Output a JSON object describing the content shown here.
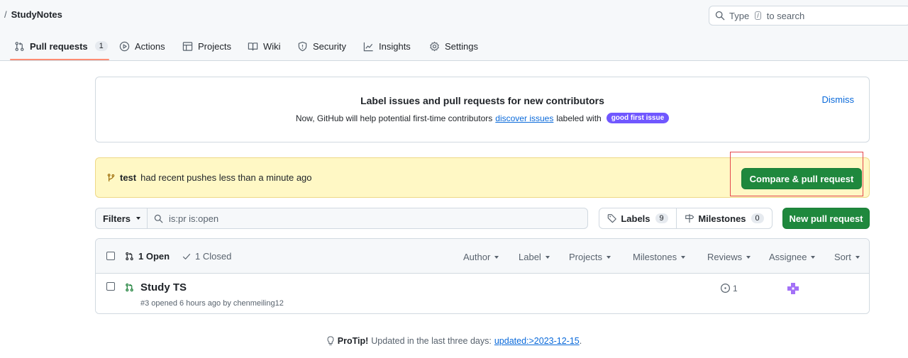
{
  "header": {
    "owner_fragment": "",
    "separator": "/",
    "repo_name": "StudyNotes",
    "search_prefix": "Type",
    "search_key": "/",
    "search_suffix": "to search"
  },
  "nav": {
    "items": [
      {
        "label": "Pull requests",
        "icon": "git-pull-request-icon",
        "counter": "1"
      },
      {
        "label": "Actions",
        "icon": "play-icon"
      },
      {
        "label": "Projects",
        "icon": "table-icon"
      },
      {
        "label": "Wiki",
        "icon": "book-icon"
      },
      {
        "label": "Security",
        "icon": "shield-icon"
      },
      {
        "label": "Insights",
        "icon": "graph-icon"
      },
      {
        "label": "Settings",
        "icon": "gear-icon"
      }
    ]
  },
  "banner": {
    "title": "Label issues and pull requests for new contributors",
    "desc_before": "Now, GitHub will help potential first-time contributors",
    "desc_link": "discover issues",
    "desc_after": "labeled with",
    "badge": "good first issue",
    "dismiss": "Dismiss"
  },
  "push": {
    "branch": "test",
    "message": "had recent pushes less than a minute ago",
    "compare_button": "Compare & pull request"
  },
  "filters": {
    "filters_label": "Filters",
    "query": "is:pr is:open",
    "labels_label": "Labels",
    "labels_count": "9",
    "milestones_label": "Milestones",
    "milestones_count": "0",
    "new_pr_button": "New pull request"
  },
  "list": {
    "open_label": "1 Open",
    "closed_label": "1 Closed",
    "columns": [
      "Author",
      "Label",
      "Projects",
      "Milestones",
      "Reviews",
      "Assignee",
      "Sort"
    ],
    "rows": [
      {
        "title": "Study TS",
        "meta": "#3 opened 6 hours ago by chenmeiling12",
        "reviews": "1"
      }
    ]
  },
  "protip": {
    "label": "ProTip!",
    "text": "Updated in the last three days:",
    "link": "updated:>2023-12-15",
    "suffix": "."
  },
  "colors": {
    "primary_button": "#1f883d",
    "link": "#0969da",
    "badge": "#7057ff",
    "highlight_box": "#e5484d",
    "push_bar": "#fff8c5"
  }
}
